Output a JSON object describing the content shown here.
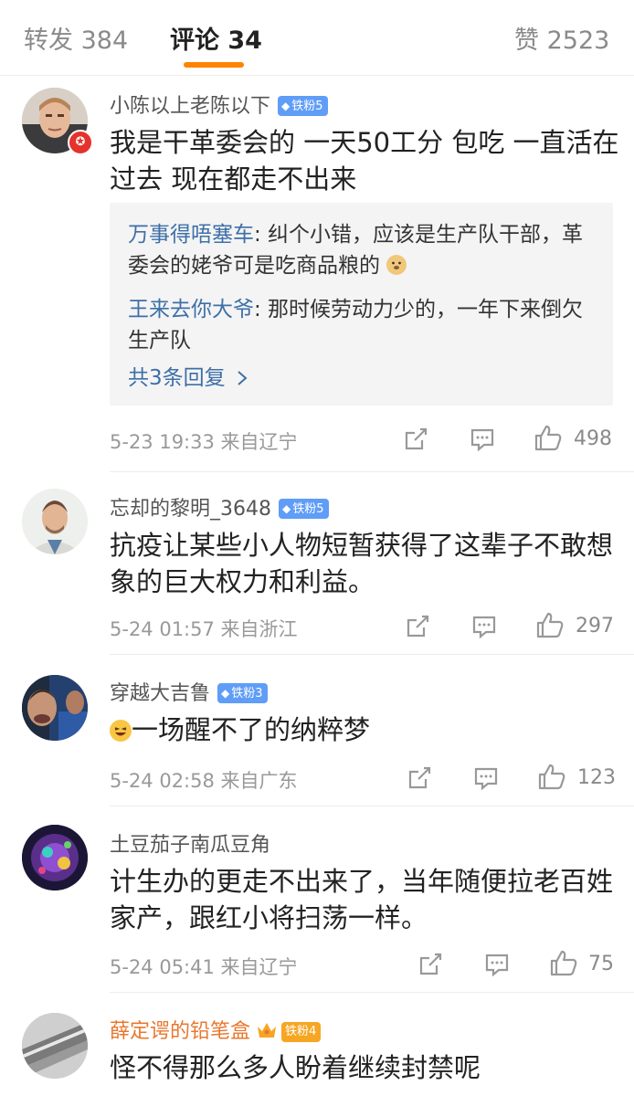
{
  "tabs": {
    "repost": "转发 384",
    "comments": "评论 34",
    "likes": "赞 2523"
  },
  "colors": {
    "accent": "#ff8200",
    "link": "#3e6fa8",
    "fan_badge": "#5f9df7",
    "gold": "#e8772e"
  },
  "comments": [
    {
      "username": "小陈以上老陈以下",
      "badge": "铁粉5",
      "text": "我是干革委会的 一天50工分 包吃 一直活在过去 现在都走不出来",
      "replies": [
        {
          "name": "万事得唔塞车",
          "text": ": 纠个小错，应该是生产队干部，革委会的姥爷可是吃商品粮的"
        },
        {
          "name": "王来去你大爷",
          "text": ": 那时候劳动力少的，一年下来倒欠生产队"
        }
      ],
      "more_replies": "共3条回复 ",
      "time": "5-23 19:33 来自辽宁",
      "likes": "498"
    },
    {
      "username": "忘却的黎明_3648",
      "badge": "铁粉5",
      "text": "抗疫让某些小人物短暂获得了这辈子不敢想象的巨大权力和利益。",
      "time": "5-24 01:57 来自浙江",
      "likes": "297"
    },
    {
      "username": "穿越大吉鲁",
      "badge": "铁粉3",
      "text": "一场醒不了的纳粹梦",
      "time": "5-24 02:58 来自广东",
      "likes": "123"
    },
    {
      "username": "土豆茄子南瓜豆角",
      "text": "计生办的更走不出来了，当年随便拉老百姓家产，跟红小将扫荡一样。",
      "time": "5-24 05:41 来自辽宁",
      "likes": "75"
    },
    {
      "username": "薛定谔的铅笔盒",
      "badge": "铁粉4",
      "text": "怪不得那么多人盼着继续封禁呢"
    }
  ]
}
